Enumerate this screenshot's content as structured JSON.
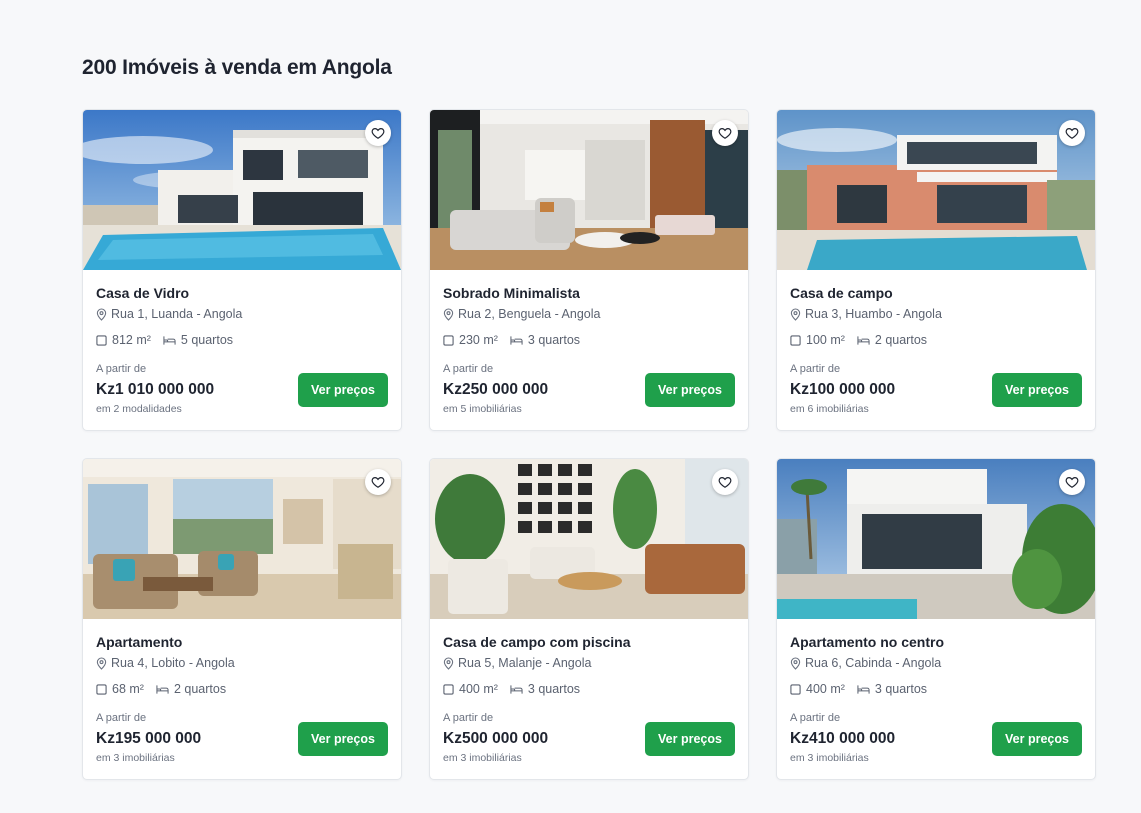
{
  "heading": "200 Imóveis à venda em Angola",
  "accent_color": "#1fa04b",
  "listings": [
    {
      "title": "Casa de Vidro",
      "location": "Rua 1, Luanda - Angola",
      "area": "812 m²",
      "bedrooms": "5 quartos",
      "from_label": "A partir de",
      "price": "Kz1 010 000 000",
      "note": "em 2 modalidades",
      "button_label": "Ver preços"
    },
    {
      "title": "Sobrado Minimalista",
      "location": "Rua 2, Benguela - Angola",
      "area": "230 m²",
      "bedrooms": "3 quartos",
      "from_label": "A partir de",
      "price": "Kz250 000 000",
      "note": "em 5 imobiliárias",
      "button_label": "Ver preços"
    },
    {
      "title": "Casa de campo",
      "location": "Rua 3, Huambo - Angola",
      "area": "100 m²",
      "bedrooms": "2 quartos",
      "from_label": "A partir de",
      "price": "Kz100 000 000",
      "note": "em 6 imobiliárias",
      "button_label": "Ver preços"
    },
    {
      "title": "Apartamento",
      "location": "Rua 4, Lobito - Angola",
      "area": "68 m²",
      "bedrooms": "2 quartos",
      "from_label": "A partir de",
      "price": "Kz195 000 000",
      "note": "em 3 imobiliárias",
      "button_label": "Ver preços"
    },
    {
      "title": "Casa de campo com piscina",
      "location": "Rua 5, Malanje - Angola",
      "area": "400 m²",
      "bedrooms": "3 quartos",
      "from_label": "A partir de",
      "price": "Kz500 000 000",
      "note": "em 3 imobiliárias",
      "button_label": "Ver preços"
    },
    {
      "title": "Apartamento no centro",
      "location": "Rua 6, Cabinda - Angola",
      "area": "400 m²",
      "bedrooms": "3 quartos",
      "from_label": "A partir de",
      "price": "Kz410 000 000",
      "note": "em 3 imobiliárias",
      "button_label": "Ver preços"
    }
  ]
}
